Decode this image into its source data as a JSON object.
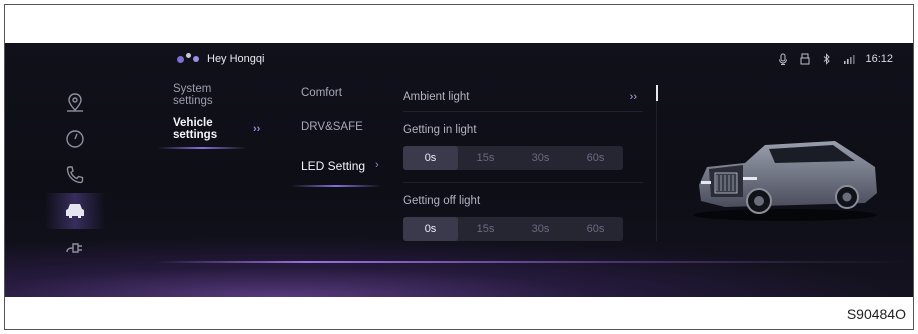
{
  "voice_assistant": {
    "label": "Hey Hongqi"
  },
  "status_bar": {
    "time": "16:12",
    "icons": [
      "mic-icon",
      "usb-icon",
      "bluetooth-icon",
      "signal-icon"
    ]
  },
  "side_rail": {
    "items": [
      {
        "icon": "navigation-icon",
        "active": false
      },
      {
        "icon": "gauge-icon",
        "active": false
      },
      {
        "icon": "phone-icon",
        "active": false
      },
      {
        "icon": "car-icon",
        "active": true
      },
      {
        "icon": "charging-icon",
        "active": false
      }
    ]
  },
  "settings_menu": {
    "system_label": "System settings",
    "vehicle_label": "Vehicle settings"
  },
  "vehicle_menu": {
    "comfort_label": "Comfort",
    "drv_safe_label": "DRV&SAFE",
    "led_label": "LED Setting"
  },
  "led_panel": {
    "ambient_light_label": "Ambient light",
    "getting_in_label": "Getting in light",
    "getting_in_options": [
      "0s",
      "15s",
      "30s",
      "60s"
    ],
    "getting_in_selected": "0s",
    "getting_off_label": "Getting off light",
    "getting_off_options": [
      "0s",
      "15s",
      "30s",
      "60s"
    ],
    "getting_off_selected": "0s"
  },
  "figure_code": "S90484O",
  "colors": {
    "screen_bg": "#10111a",
    "accent": "#9a86e0",
    "selected_segment": "#3a3a4c"
  }
}
